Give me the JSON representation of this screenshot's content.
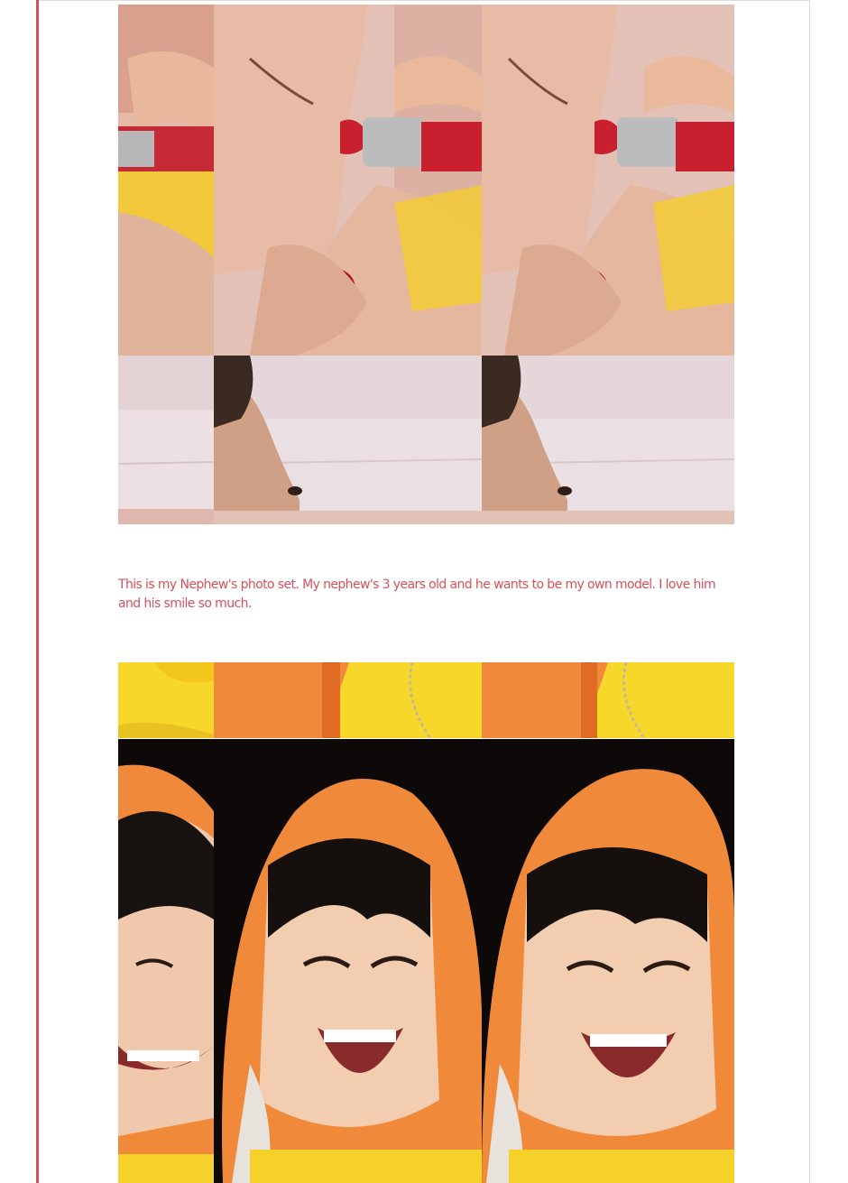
{
  "post": {
    "caption": "This is my Nephew's photo set. My nephew's 3 years old and he wants to be my own model. I love him and his smile so much."
  },
  "photo_set_1": {
    "top_row": [
      "lipstick-crop-left",
      "lipstick-crop-center",
      "lipstick-crop-right"
    ],
    "bottom_row": [
      "profile-crop-left",
      "profile-crop-center",
      "profile-crop-right"
    ]
  },
  "photo_set_2": {
    "top_row": [
      "jacket-crop-left",
      "jacket-crop-center",
      "jacket-crop-right"
    ],
    "bottom_row": [
      "smile-crop-left",
      "smile-crop-center",
      "smile-crop-right"
    ]
  },
  "colors": {
    "accent": "#d4515b",
    "lipstick": "#c8202f",
    "jacket": "#f07a2a",
    "shirt": "#f7d21f"
  }
}
